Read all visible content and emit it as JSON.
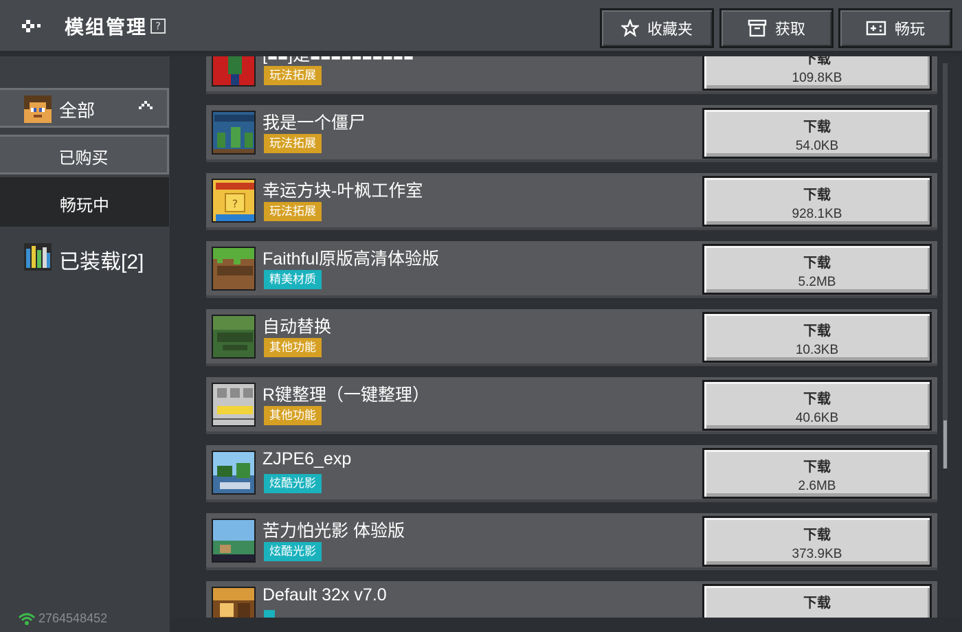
{
  "header": {
    "title": "模组管理",
    "help_symbol": "?",
    "favorites_label": "收藏夹",
    "get_label": "获取",
    "play_label": "畅玩"
  },
  "sidebar": {
    "items": [
      {
        "label": "全部"
      },
      {
        "label": "已购买"
      },
      {
        "label": "畅玩中"
      },
      {
        "label": "已装载[2]"
      }
    ],
    "user_id": "2764548452"
  },
  "mods": [
    {
      "name": "[■■]是■■■■■■■■■■",
      "tag": "玩法拓展",
      "tag_color": "#d5a023",
      "button": "下载",
      "size": "109.8KB",
      "thumb": "red-block-icon"
    },
    {
      "name": "我是一个僵尸",
      "tag": "玩法拓展",
      "tag_color": "#d5a023",
      "button": "下载",
      "size": "54.0KB",
      "thumb": "zombie-thumb-icon"
    },
    {
      "name": "幸运方块-叶枫工作室",
      "tag": "玩法拓展",
      "tag_color": "#d5a023",
      "button": "下载",
      "size": "928.1KB",
      "thumb": "lucky-block-icon"
    },
    {
      "name": "Faithful原版高清体验版",
      "tag": "精美材质",
      "tag_color": "#1ab2bd",
      "button": "下载",
      "size": "5.2MB",
      "thumb": "grass-block-icon"
    },
    {
      "name": "自动替换",
      "tag": "其他功能",
      "tag_color": "#d5a023",
      "button": "下载",
      "size": "10.3KB",
      "thumb": "auto-replace-icon"
    },
    {
      "name": "R键整理（一键整理）",
      "tag": "其他功能",
      "tag_color": "#d5a023",
      "button": "下载",
      "size": "40.6KB",
      "thumb": "inventory-icon"
    },
    {
      "name": "ZJPE6_exp",
      "tag": "炫酷光影",
      "tag_color": "#1ab2bd",
      "button": "下载",
      "size": "2.6MB",
      "thumb": "landscape-icon"
    },
    {
      "name": "苦力怕光影 体验版",
      "tag": "炫酷光影",
      "tag_color": "#1ab2bd",
      "button": "下载",
      "size": "373.9KB",
      "thumb": "creeper-shader-icon"
    },
    {
      "name": "Default 32x v7.0",
      "tag": "",
      "tag_color": "#1ab2bd",
      "button": "下载",
      "size": "",
      "thumb": "house-icon"
    }
  ]
}
